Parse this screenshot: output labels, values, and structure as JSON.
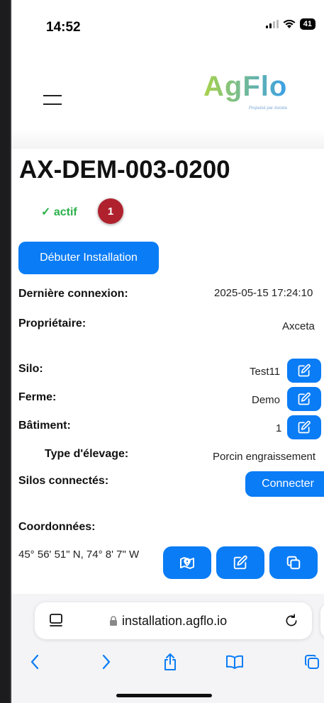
{
  "status_bar": {
    "time": "14:52",
    "battery": "41"
  },
  "brand": {
    "logo": "AgFlo",
    "tagline": "Propulsé par Axceta"
  },
  "device": {
    "id": "AX-DEM-003-0200",
    "status": "✓ actif",
    "notification_count": "1"
  },
  "actions": {
    "start_install": "Débuter Installation",
    "connect": "Connecter"
  },
  "fields": {
    "last_connection": {
      "label": "Dernière connexion:",
      "value": "2025-05-15 17:24:10"
    },
    "owner": {
      "label": "Propriétaire:",
      "value": "Axceta"
    },
    "silo": {
      "label": "Silo:",
      "value": "Test11"
    },
    "farm": {
      "label": "Ferme:",
      "value": "Demo"
    },
    "building": {
      "label": "Bâtiment:",
      "value": "1"
    },
    "breeding_type": {
      "label": "Type d'élevage:",
      "value": "Porcin engraissement"
    },
    "connected_silos": {
      "label": "Silos connectés:"
    },
    "coordinates": {
      "label": "Coordonnées:",
      "value": "45° 56' 51\" N, 74° 8' 7\" W"
    }
  },
  "browser": {
    "url": "installation.agflo.io"
  },
  "colors": {
    "primary": "#0a7cf5",
    "active": "#2bb14a",
    "badge": "#b0212e"
  },
  "icons": [
    "hamburger-icon",
    "edit-icon",
    "map-pin-icon",
    "copy-icon",
    "lock-icon",
    "reload-icon",
    "back-icon",
    "forward-icon",
    "share-icon",
    "bookmarks-icon",
    "tabs-icon",
    "tab-view-icon"
  ]
}
